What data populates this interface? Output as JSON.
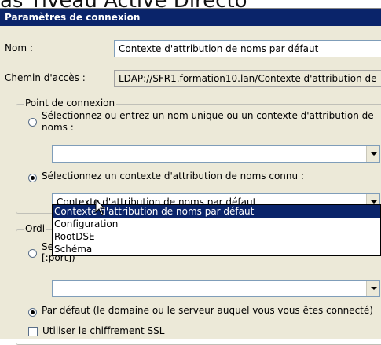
{
  "background_title": "as Tiveau Active Directo",
  "dialog": {
    "title": "Paramètres de connexion",
    "name_label": "Nom :",
    "name_value": "Contexte d'attribution de noms par défaut",
    "path_label": "Chemin d'accès :",
    "path_value": "LDAP://SFR1.formation10.lan/Contexte d'attribution de",
    "connection_point": {
      "legend": "Point de connexion",
      "radio1_label": "Sélectionnez ou entrez un nom unique ou un contexte d'attribution de noms :",
      "radio1_selected": false,
      "input1_value": "",
      "radio2_label": "Sélectionnez un contexte d'attribution de noms connu :",
      "radio2_selected": true,
      "combo_value": "Contexte d'attribution de noms par défaut",
      "dropdown_options": [
        "Contexte d'attribution de noms par défaut",
        "Configuration",
        "RootDSE",
        "Schéma"
      ],
      "dropdown_selected_index": 0
    },
    "computer": {
      "legend_partial": "Ordi",
      "radio_partial_line1": "Se",
      "radio_partial_line2": "[:port])",
      "input_value": "",
      "default_radio_label": "Par défaut (le domaine ou le serveur auquel vous vous êtes connecté)",
      "default_radio_selected": true,
      "ssl_checkbox_label": "Utiliser le chiffrement SSL",
      "ssl_checked": false
    }
  },
  "colors": {
    "titlebar": "#0a246a",
    "dialog_bg": "#ece9d8",
    "selection": "#0a246a"
  }
}
